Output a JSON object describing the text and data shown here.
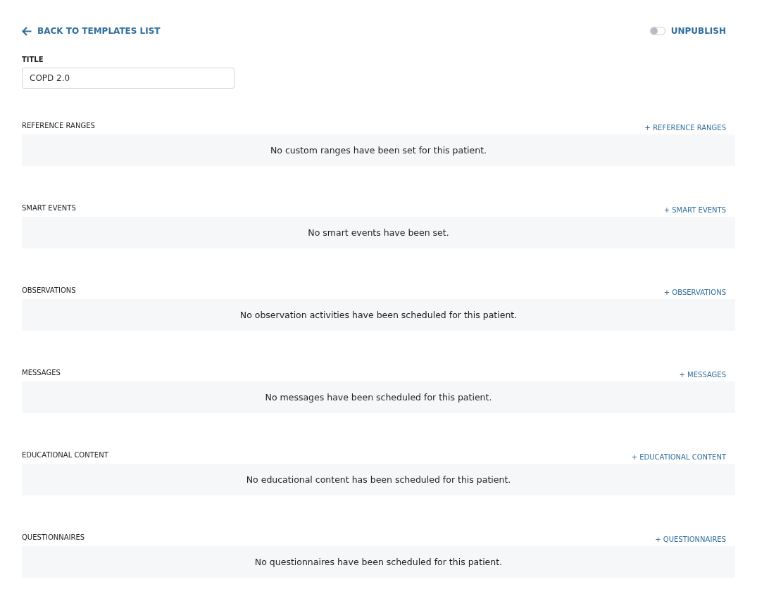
{
  "back_link": {
    "label": "BACK TO TEMPLATES LIST"
  },
  "publish_toggle": {
    "label": "UNPUBLISH",
    "on": false
  },
  "title_field": {
    "label": "TITLE",
    "value": "COPD 2.0"
  },
  "sections": [
    {
      "heading": "REFERENCE RANGES",
      "add_label": "+ REFERENCE RANGES",
      "empty_message": "No custom ranges have been set for this patient."
    },
    {
      "heading": "SMART EVENTS",
      "add_label": "+ SMART EVENTS",
      "empty_message": "No smart events have been set."
    },
    {
      "heading": "OBSERVATIONS",
      "add_label": "+ OBSERVATIONS",
      "empty_message": "No observation activities have been scheduled for this patient."
    },
    {
      "heading": "MESSAGES",
      "add_label": "+ MESSAGES",
      "empty_message": "No messages have been scheduled for this patient."
    },
    {
      "heading": "EDUCATIONAL CONTENT",
      "add_label": "+ EDUCATIONAL CONTENT",
      "empty_message": "No educational content has been scheduled for this patient."
    },
    {
      "heading": "QUESTIONNAIRES",
      "add_label": "+ QUESTIONNAIRES",
      "empty_message": "No questionnaires have been scheduled for this patient."
    }
  ]
}
